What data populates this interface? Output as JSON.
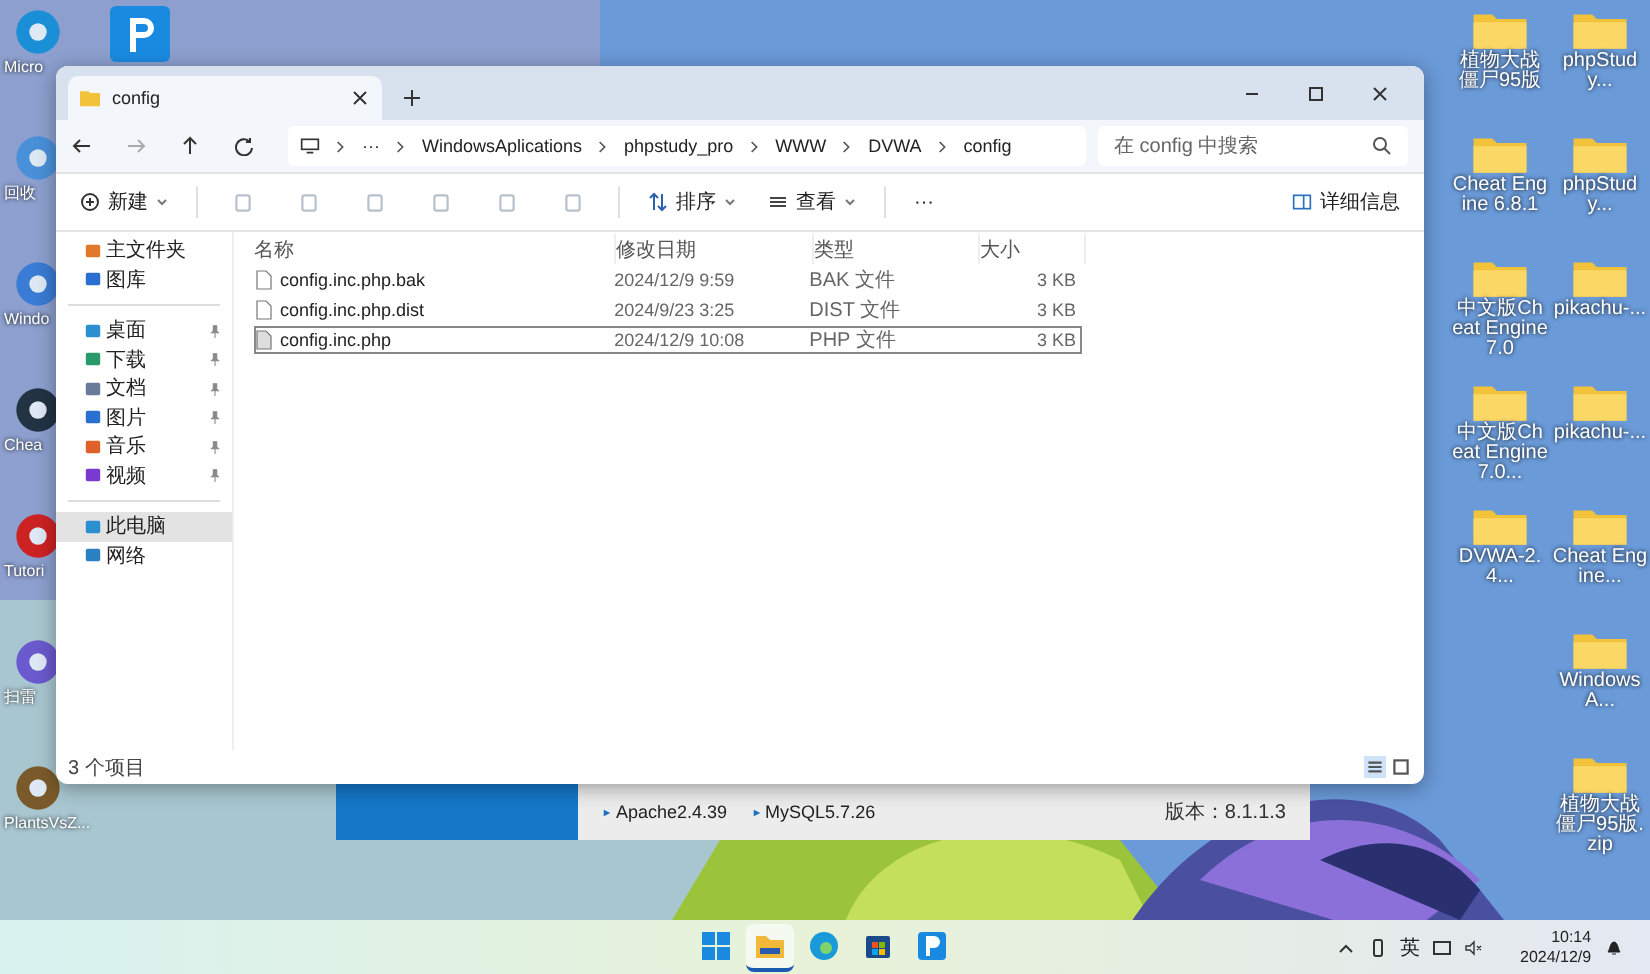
{
  "desktop": {
    "left_icons": [
      {
        "label": "Micro"
      },
      {
        "label": "回收"
      },
      {
        "label": "Windo"
      },
      {
        "label": "Chea"
      },
      {
        "label": "Tutori"
      },
      {
        "label": "扫雷"
      },
      {
        "label": "PlantsVsZ..."
      }
    ],
    "right_column_1": [
      {
        "label": "植物大战僵尸95版"
      },
      {
        "label": "Cheat Engine 6.8.1"
      },
      {
        "label": "中文版Cheat Engine 7.0"
      },
      {
        "label": "中文版Cheat Engine 7.0..."
      },
      {
        "label": "DVWA-2.4..."
      }
    ],
    "right_column_2": [
      {
        "label": "phpStudy..."
      },
      {
        "label": "phpStudy..."
      },
      {
        "label": "pikachu-..."
      },
      {
        "label": "pikachu-..."
      },
      {
        "label": "Cheat Engine..."
      },
      {
        "label": "WindowsA..."
      },
      {
        "label": "植物大战僵尸95版.zip"
      }
    ]
  },
  "explorer": {
    "tab": {
      "title": "config"
    },
    "path": [
      "···",
      "WindowsAplications",
      "phpstudy_pro",
      "WWW",
      "DVWA",
      "config"
    ],
    "search": {
      "placeholder": "在 config 中搜索"
    },
    "toolbar": {
      "new": "新建",
      "sort": "排序",
      "view": "查看",
      "more": "···",
      "details": "详细信息"
    },
    "sidebar": [
      {
        "label": "主文件夹",
        "pinned": false,
        "selected": false
      },
      {
        "label": "图库",
        "pinned": false,
        "selected": false
      },
      {
        "label": "桌面",
        "pinned": true,
        "selected": false
      },
      {
        "label": "下载",
        "pinned": true,
        "selected": false
      },
      {
        "label": "文档",
        "pinned": true,
        "selected": false
      },
      {
        "label": "图片",
        "pinned": true,
        "selected": false
      },
      {
        "label": "音乐",
        "pinned": true,
        "selected": false
      },
      {
        "label": "视频",
        "pinned": true,
        "selected": false
      },
      {
        "label": "此电脑",
        "pinned": false,
        "selected": true
      },
      {
        "label": "网络",
        "pinned": false,
        "selected": false
      }
    ],
    "columns": [
      "名称",
      "修改日期",
      "类型",
      "大小"
    ],
    "rows": [
      {
        "name": "config.inc.php.bak",
        "date": "2024/12/9 9:59",
        "type": "BAK 文件",
        "size": "3 KB",
        "selected": false
      },
      {
        "name": "config.inc.php.dist",
        "date": "2024/9/23 3:25",
        "type": "DIST 文件",
        "size": "3 KB",
        "selected": false
      },
      {
        "name": "config.inc.php",
        "date": "2024/12/9 10:08",
        "type": "PHP 文件",
        "size": "3 KB",
        "selected": true
      }
    ],
    "status": "3 个项目"
  },
  "phpstudy": {
    "services": [
      "Apache2.4.39",
      "MySQL5.7.26"
    ],
    "version": "版本：8.1.1.3"
  },
  "taskbar": {
    "apps": [
      {
        "selected": false
      },
      {
        "selected": true
      },
      {
        "selected": false
      },
      {
        "selected": false
      },
      {
        "selected": false
      }
    ],
    "ime": "英",
    "time": "10:14",
    "date": "2024/12/9"
  }
}
